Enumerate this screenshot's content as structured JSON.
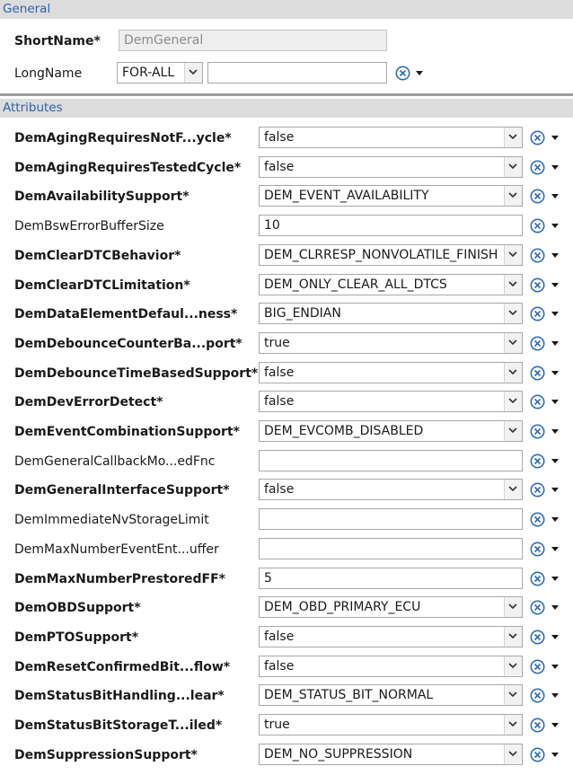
{
  "general": {
    "header": "General",
    "short_name": {
      "label": "ShortName*",
      "value": "DemGeneral"
    },
    "long_name": {
      "label": "LongName",
      "language": "FOR-ALL",
      "value": ""
    }
  },
  "attributes": {
    "header": "Attributes",
    "rows": [
      {
        "label": "DemAgingRequiresNotF...ycle*",
        "bold": true,
        "kind": "select",
        "value": "false"
      },
      {
        "label": "DemAgingRequiresTestedCycle*",
        "bold": true,
        "kind": "select",
        "value": "false"
      },
      {
        "label": "DemAvailabilitySupport*",
        "bold": true,
        "kind": "select",
        "value": "DEM_EVENT_AVAILABILITY"
      },
      {
        "label": "DemBswErrorBufferSize",
        "bold": false,
        "kind": "text",
        "value": "10"
      },
      {
        "label": "DemClearDTCBehavior*",
        "bold": true,
        "kind": "select",
        "value": "DEM_CLRRESP_NONVOLATILE_FINISH"
      },
      {
        "label": "DemClearDTCLimitation*",
        "bold": true,
        "kind": "select",
        "value": "DEM_ONLY_CLEAR_ALL_DTCS"
      },
      {
        "label": "DemDataElementDefaul...ness*",
        "bold": true,
        "kind": "select",
        "value": "BIG_ENDIAN"
      },
      {
        "label": "DemDebounceCounterBa...port*",
        "bold": true,
        "kind": "select",
        "value": "true"
      },
      {
        "label": "DemDebounceTimeBasedSupport*",
        "bold": true,
        "kind": "select",
        "value": "false"
      },
      {
        "label": "DemDevErrorDetect*",
        "bold": true,
        "kind": "select",
        "value": "false"
      },
      {
        "label": "DemEventCombinationSupport*",
        "bold": true,
        "kind": "select",
        "value": "DEM_EVCOMB_DISABLED"
      },
      {
        "label": "DemGeneralCallbackMo...edFnc",
        "bold": false,
        "kind": "text",
        "value": ""
      },
      {
        "label": "DemGeneralInterfaceSupport*",
        "bold": true,
        "kind": "select",
        "value": "false"
      },
      {
        "label": "DemImmediateNvStorageLimit",
        "bold": false,
        "kind": "text",
        "value": ""
      },
      {
        "label": "DemMaxNumberEventEnt...uffer",
        "bold": false,
        "kind": "text",
        "value": ""
      },
      {
        "label": "DemMaxNumberPrestoredFF*",
        "bold": true,
        "kind": "text",
        "value": "5"
      },
      {
        "label": "DemOBDSupport*",
        "bold": true,
        "kind": "select",
        "value": "DEM_OBD_PRIMARY_ECU"
      },
      {
        "label": "DemPTOSupport*",
        "bold": true,
        "kind": "select",
        "value": "false"
      },
      {
        "label": "DemResetConfirmedBit...flow*",
        "bold": true,
        "kind": "select",
        "value": "false"
      },
      {
        "label": "DemStatusBitHandling...lear*",
        "bold": true,
        "kind": "select",
        "value": "DEM_STATUS_BIT_NORMAL"
      },
      {
        "label": "DemStatusBitStorageT...iled*",
        "bold": true,
        "kind": "select",
        "value": "true"
      },
      {
        "label": "DemSuppressionSupport*",
        "bold": true,
        "kind": "select",
        "value": "DEM_NO_SUPPRESSION"
      }
    ]
  },
  "icons": {
    "reset": "reset-default-icon",
    "menu": "dropdown-menu-icon",
    "chevron": "chevron-down-icon"
  },
  "colors": {
    "header_bg": "#dcdcdc",
    "header_text": "#2f5fa8",
    "icon_blue": "#2f6db5"
  }
}
